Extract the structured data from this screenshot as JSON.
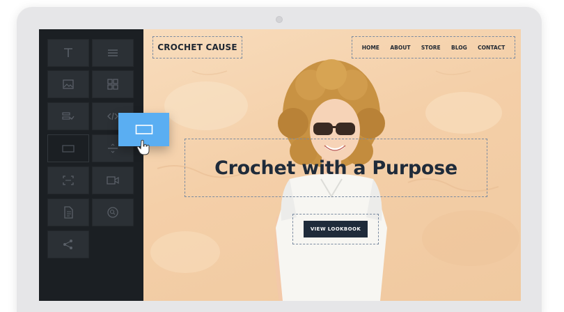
{
  "builder": {
    "tools": [
      {
        "icon": "text-icon"
      },
      {
        "icon": "lines-icon"
      },
      {
        "icon": "image-icon"
      },
      {
        "icon": "gallery-icon"
      },
      {
        "icon": "form-icon"
      },
      {
        "icon": "code-icon"
      },
      {
        "icon": "button-block-icon"
      },
      {
        "icon": "divider-icon"
      },
      {
        "icon": "expand-icon"
      },
      {
        "icon": "video-icon"
      },
      {
        "icon": "document-icon"
      },
      {
        "icon": "search-icon"
      },
      {
        "icon": "share-icon"
      }
    ],
    "dragging_item": "button-block-icon"
  },
  "site": {
    "logo": "CROCHET CAUSE",
    "nav": [
      "HOME",
      "ABOUT",
      "STORE",
      "BLOG",
      "CONTACT"
    ],
    "headline": "Crochet with a Purpose",
    "cta_label": "VIEW LOOKBOOK"
  },
  "colors": {
    "sidebar_bg": "#1b1f23",
    "tool_bg": "#2b3035",
    "drag_accent": "#5aaef2",
    "site_bg": "#f4cfa8",
    "text_dark": "#1f2b3a"
  }
}
